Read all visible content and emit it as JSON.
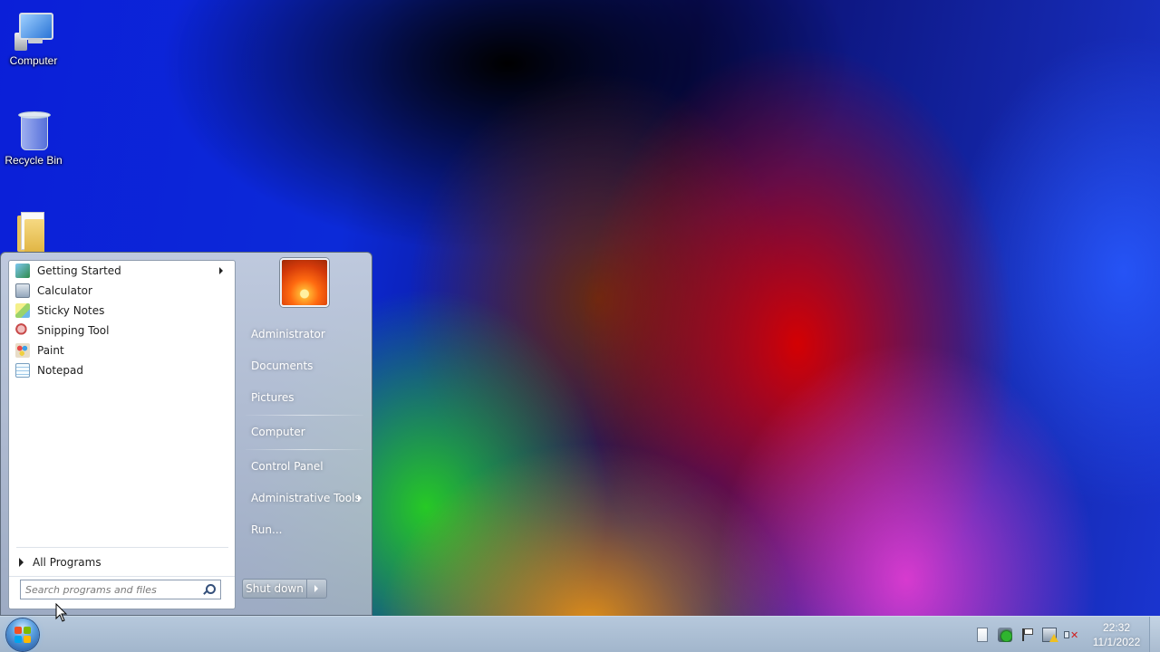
{
  "desktop": {
    "icons": [
      {
        "label": "Computer"
      },
      {
        "label": "Recycle Bin"
      },
      {
        "label": ""
      }
    ]
  },
  "start_menu": {
    "programs": [
      {
        "label": "Getting Started",
        "icon": "getting-started-icon",
        "has_submenu": true
      },
      {
        "label": "Calculator",
        "icon": "calculator-icon"
      },
      {
        "label": "Sticky Notes",
        "icon": "sticky-notes-icon"
      },
      {
        "label": "Snipping Tool",
        "icon": "snipping-tool-icon"
      },
      {
        "label": "Paint",
        "icon": "paint-icon"
      },
      {
        "label": "Notepad",
        "icon": "notepad-icon"
      }
    ],
    "all_programs_label": "All Programs",
    "search": {
      "placeholder": "Search programs and files",
      "value": ""
    },
    "right_items": [
      {
        "label": "Administrator"
      },
      {
        "label": "Documents"
      },
      {
        "label": "Pictures"
      },
      {
        "label": "Computer"
      },
      {
        "label": "Control Panel"
      },
      {
        "label": "Administrative Tools",
        "has_submenu": true
      },
      {
        "label": "Run..."
      }
    ],
    "shutdown_label": "Shut down"
  },
  "taskbar": {
    "tray_icons": [
      "action-center-doc-icon",
      "security-shield-icon",
      "flag-icon",
      "network-warning-icon",
      "volume-muted-icon"
    ],
    "clock": {
      "time": "22:32",
      "date": "11/1/2022"
    }
  },
  "colors": {
    "taskbar": "#a8bbd0",
    "start_menu_left_bg": "#ffffff",
    "start_menu_right_text": "#ffffff"
  }
}
